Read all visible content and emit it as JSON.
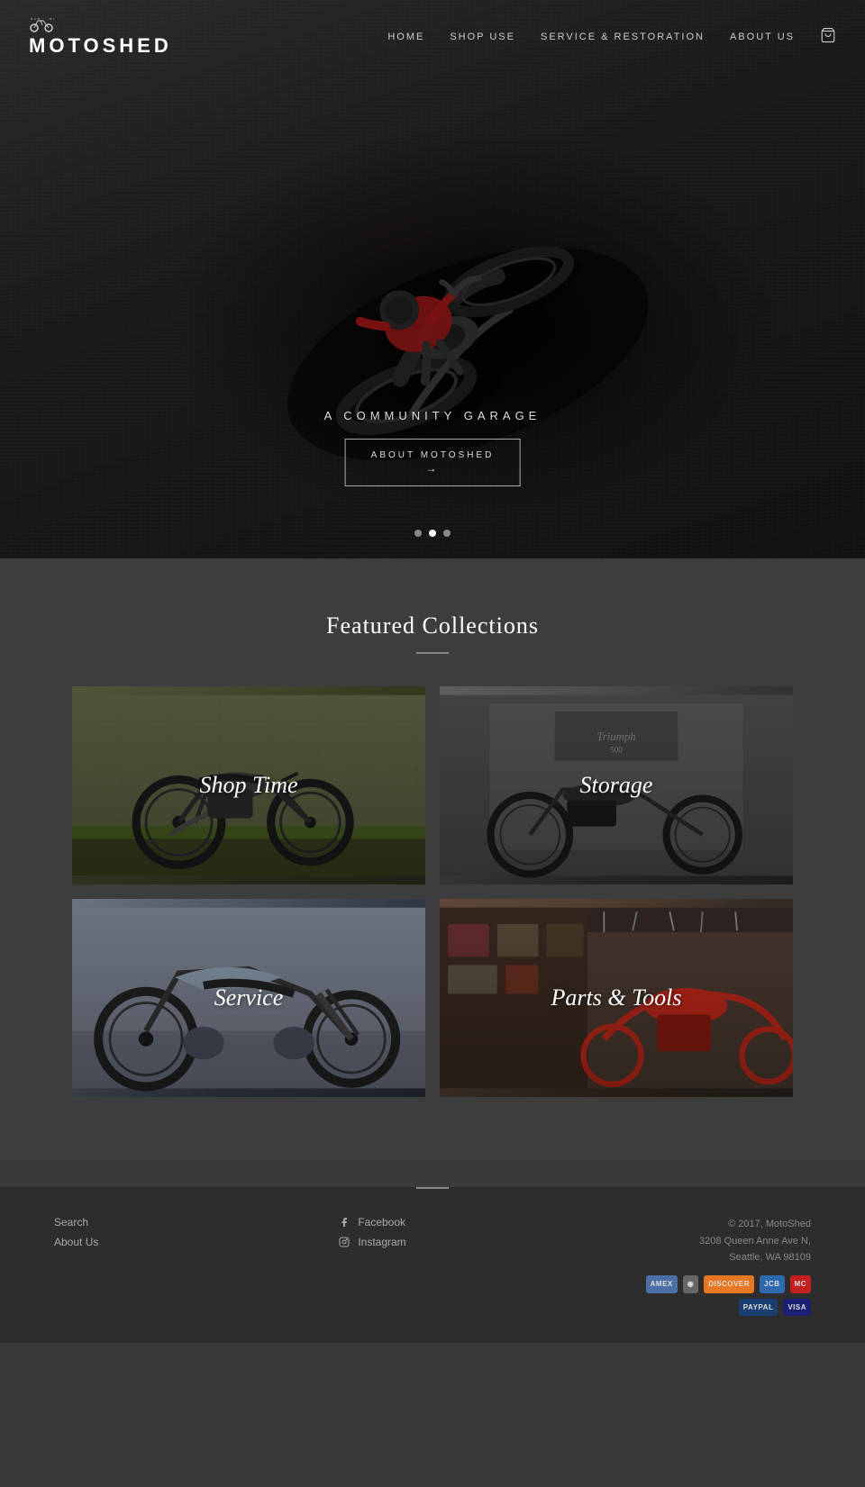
{
  "brand": {
    "name": "MOTOSHED",
    "tagline": "BAR · MI",
    "logo_icon": "motorcycle"
  },
  "nav": {
    "items": [
      {
        "label": "HOME",
        "href": "#"
      },
      {
        "label": "SHOP USE",
        "href": "#"
      },
      {
        "label": "SERVICE & RESTORATION",
        "href": "#"
      },
      {
        "label": "ABOUT US",
        "href": "#"
      }
    ],
    "cart_label": "cart"
  },
  "hero": {
    "subtitle": "A COMMUNITY GARAGE",
    "cta_label": "ABOUT MOTOSHED",
    "cta_arrow": "→",
    "dots": [
      {
        "active": false
      },
      {
        "active": true
      },
      {
        "active": false
      }
    ]
  },
  "featured": {
    "section_title": "Featured Collections",
    "collections": [
      {
        "label": "Shop Time",
        "id": "shop-time"
      },
      {
        "label": "Storage",
        "id": "storage"
      },
      {
        "label": "Service",
        "id": "service"
      },
      {
        "label": "Parts & Tools",
        "id": "parts-tools"
      }
    ]
  },
  "footer": {
    "links": [
      {
        "label": "Search"
      },
      {
        "label": "About Us"
      }
    ],
    "socials": [
      {
        "label": "Facebook",
        "icon": "f"
      },
      {
        "label": "Instagram",
        "icon": "◉"
      }
    ],
    "copyright": "© 2017, MotoShed",
    "address_line1": "3208 Queen Anne Ave N,",
    "address_line2": "Seattle, WA 98109",
    "payment_methods": [
      {
        "label": "AMEX",
        "class": "amex"
      },
      {
        "label": "◉",
        "class": "diners"
      },
      {
        "label": "DISCOVER",
        "class": "discover"
      },
      {
        "label": "JCB",
        "class": "jcb"
      },
      {
        "label": "⬤⬤",
        "class": "master"
      }
    ],
    "payment_row2": [
      {
        "label": "PayPal",
        "class": "paypal"
      },
      {
        "label": "VISA",
        "class": "visa"
      }
    ]
  }
}
